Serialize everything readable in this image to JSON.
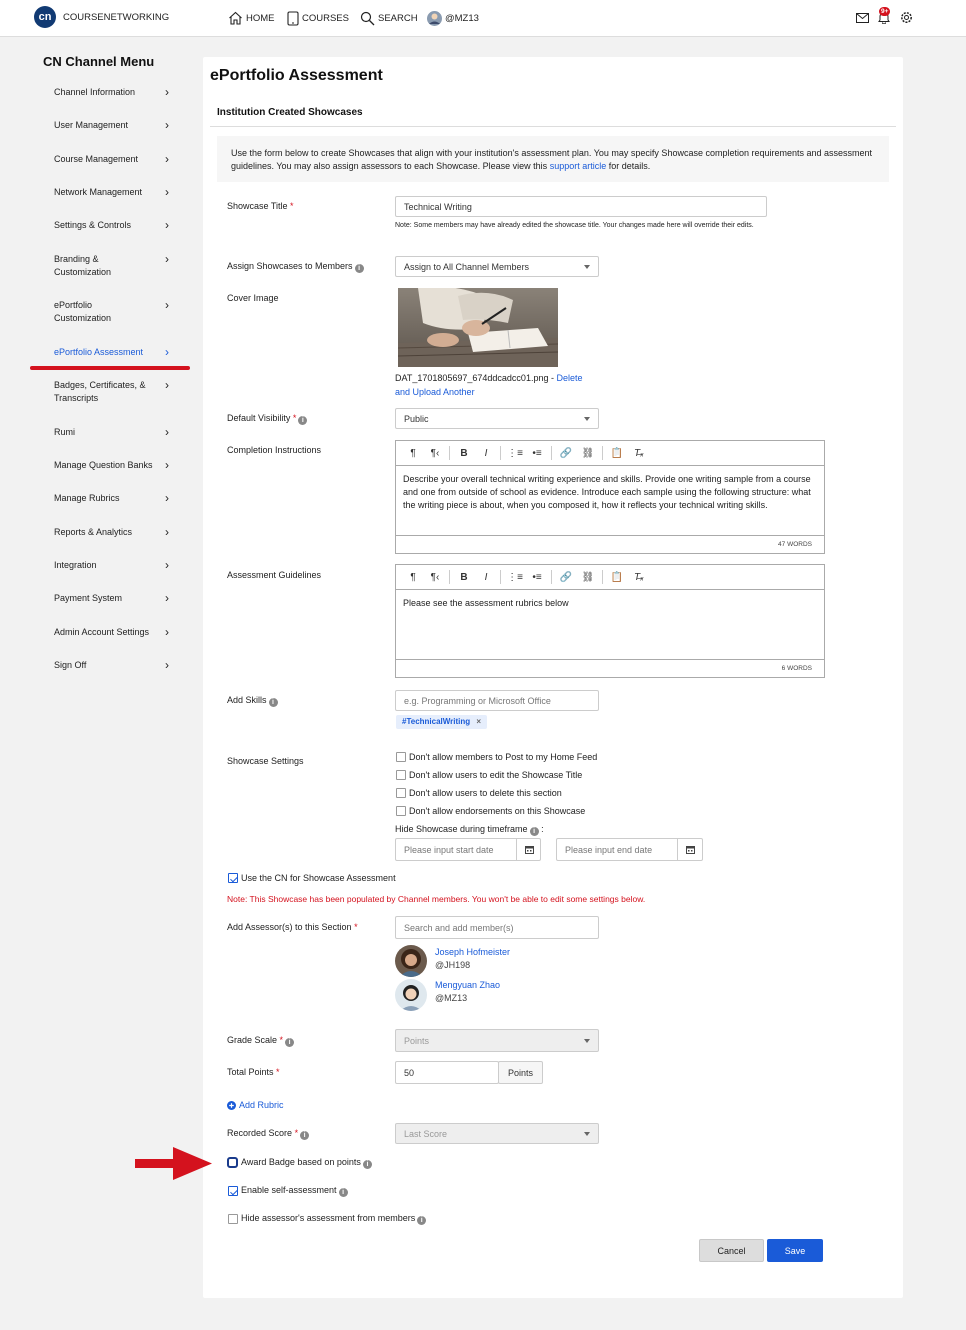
{
  "topbar": {
    "brand": "COURSENETWORKING",
    "logo_text": "cn",
    "nav": [
      {
        "label": "HOME",
        "icon": "home-icon"
      },
      {
        "label": "COURSES",
        "icon": "tablet-icon"
      },
      {
        "label": "SEARCH",
        "icon": "search-icon"
      },
      {
        "label": "@MZ13",
        "icon": "avatar"
      }
    ],
    "notification_badge": "9+"
  },
  "sidebar": {
    "title": "CN Channel Menu",
    "items": [
      {
        "label": "Channel Information"
      },
      {
        "label": "User Management"
      },
      {
        "label": "Course Management"
      },
      {
        "label": "Network Management"
      },
      {
        "label": "Settings & Controls"
      },
      {
        "label": "Branding &\nCustomization"
      },
      {
        "label": "ePortfolio\nCustomization"
      },
      {
        "label": "ePortfolio Assessment"
      },
      {
        "label": "Badges, Certificates, &\nTranscripts"
      },
      {
        "label": "Rumi"
      },
      {
        "label": "Manage Question Banks"
      },
      {
        "label": "Manage Rubrics"
      },
      {
        "label": "Reports & Analytics"
      },
      {
        "label": "Integration"
      },
      {
        "label": "Payment System"
      },
      {
        "label": "Admin Account Settings"
      },
      {
        "label": "Sign Off"
      }
    ],
    "active_index": 7
  },
  "main": {
    "page_title": "ePortfolio Assessment",
    "section_title": "Institution Created Showcases",
    "intro_text": "Use the form below to create Showcases that align with your institution's assessment plan. You may specify Showcase completion requirements and assessment guidelines. You may also assign assessors to each Showcase. Please view this ",
    "intro_link": "support article",
    "intro_end": " for details.",
    "showcase_title": {
      "label": "Showcase Title",
      "value": "Technical Writing",
      "note": "Note: Some members may have already edited the showcase title. Your changes made here will override their edits."
    },
    "assign": {
      "label": "Assign Showcases to Members",
      "value": "Assign to All Channel Members"
    },
    "cover": {
      "label": "Cover Image",
      "filename": "DAT_1701805697_674ddcadcc01.png",
      "sep": " - ",
      "link1": "Delete",
      "link2": "and Upload Another"
    },
    "visibility": {
      "label": "Default Visibility",
      "value": "Public"
    },
    "completion": {
      "label": "Completion Instructions",
      "text": "Describe your overall technical writing experience and skills. Provide one writing sample from a course and one from outside of school as evidence. Introduce each sample using the following structure: what the writing piece is about, when you composed it, how it reflects your technical writing skills.",
      "words": "47 WORDS"
    },
    "guidelines": {
      "label": "Assessment Guidelines",
      "text": "Please see the assessment rubrics below",
      "words": "6 WORDS"
    },
    "skills": {
      "label": "Add Skills",
      "placeholder": "e.g. Programming or Microsoft Office",
      "tag": "#TechnicalWriting"
    },
    "settings": {
      "label": "Showcase Settings",
      "options": [
        "Don't allow members to Post to my Home Feed",
        "Don't allow users to edit the Showcase Title",
        "Don't allow users to delete this section",
        "Don't allow endorsements on this Showcase"
      ],
      "hide_label": "Hide Showcase during timeframe",
      "start_ph": "Please input start date",
      "end_ph": "Please input end date"
    },
    "use_cn": {
      "label": "Use the CN for Showcase Assessment",
      "checked": true
    },
    "warning": "Note: This Showcase has been populated by Channel members. You won't be able to edit some settings below.",
    "assessors": {
      "label": "Add Assessor(s) to this Section",
      "placeholder": "Search and add member(s)",
      "people": [
        {
          "name": "Joseph Hofmeister",
          "handle": "@JH198"
        },
        {
          "name": "Mengyuan Zhao",
          "handle": "@MZ13"
        }
      ]
    },
    "grade_scale": {
      "label": "Grade Scale",
      "value": "Points"
    },
    "total_points": {
      "label": "Total Points",
      "value": "50",
      "unit": "Points"
    },
    "add_rubric": "Add Rubric",
    "recorded_score": {
      "label": "Recorded Score",
      "value": "Last Score"
    },
    "award_badge": {
      "label": "Award Badge based on points",
      "checked": false
    },
    "self_assessment": {
      "label": "Enable self-assessment",
      "checked": true
    },
    "hide_assessor": {
      "label": "Hide assessor's assessment from members",
      "checked": false
    },
    "cancel_label": "Cancel",
    "save_label": "Save"
  },
  "colors": {
    "accent": "#1a5bd8",
    "danger": "#d4121e",
    "brand": "#113a73"
  }
}
